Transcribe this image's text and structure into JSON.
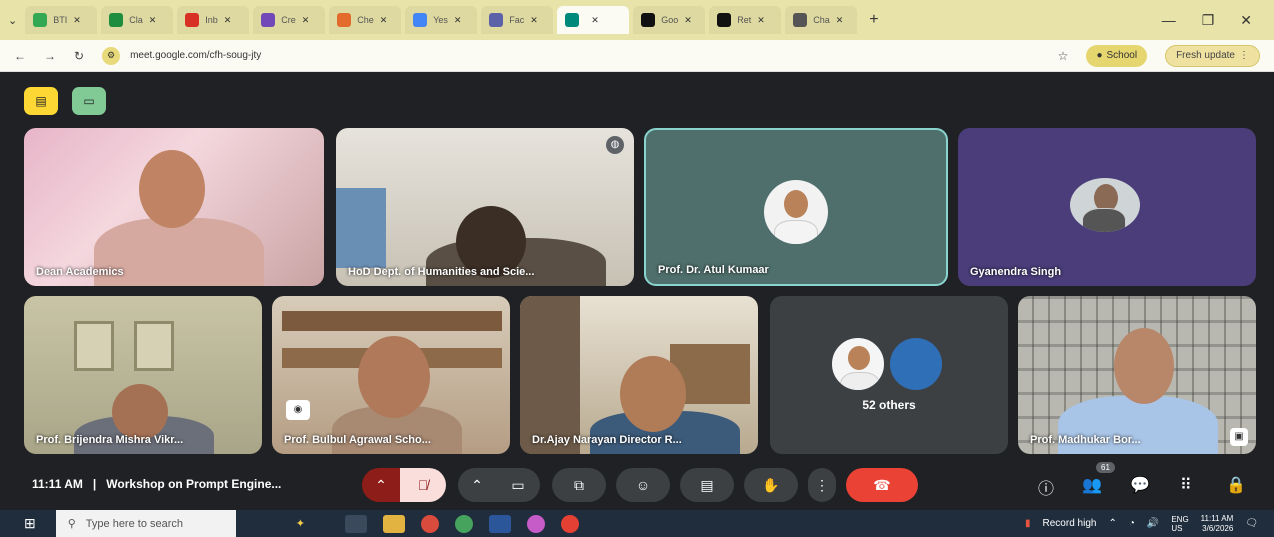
{
  "browser": {
    "tabs": [
      {
        "label": "BTI",
        "icon": "google-drive-icon",
        "color": "#34a853"
      },
      {
        "label": "Cla",
        "icon": "classroom-icon",
        "color": "#1e8e3e"
      },
      {
        "label": "Inb",
        "icon": "gmail-icon",
        "color": "#d93025"
      },
      {
        "label": "Cre",
        "icon": "forms-icon",
        "color": "#7248b9"
      },
      {
        "label": "Che",
        "icon": "ai-icon",
        "color": "#e36c2d"
      },
      {
        "label": "Yes",
        "icon": "star-icon",
        "color": "#4285f4"
      },
      {
        "label": "Fac",
        "icon": "heart-icon",
        "color": "#5b62a7"
      },
      {
        "label": "",
        "icon": "meet-icon",
        "color": "#00897b",
        "active": true
      },
      {
        "label": "Goo",
        "icon": "chatgpt-icon",
        "color": "#111111"
      },
      {
        "label": "Ret",
        "icon": "chatgpt-icon",
        "color": "#111111"
      },
      {
        "label": "Cha",
        "icon": "gear-icon",
        "color": "#555555"
      }
    ],
    "url": "meet.google.com/cfh-soug-jty",
    "profile_label": "School",
    "update_label": "Fresh update"
  },
  "participants": [
    {
      "name": "Dean Academics"
    },
    {
      "name": "HoD Dept. of Humanities and Scie..."
    },
    {
      "name": "Prof. Dr. Atul Kumaar"
    },
    {
      "name": "Gyanendra Singh"
    },
    {
      "name": "Prof. Brijendra Mishra Vikr..."
    },
    {
      "name": "Prof. Bulbul Agrawal Scho..."
    },
    {
      "name": "Dr.Ajay Narayan Director R..."
    },
    {
      "name": "52 others"
    },
    {
      "name": "Prof. Madhukar Bor..."
    }
  ],
  "meeting": {
    "time": "11:11 AM",
    "separator": "|",
    "title": "Workshop on Prompt Engine...",
    "people_count": "61"
  },
  "taskbar": {
    "search_placeholder": "Type here to search",
    "weather": "Record high",
    "lang": "ENG",
    "region": "US",
    "clock_time": "11:11 AM",
    "clock_date": "3/6/2026"
  },
  "colors": {
    "accent_red": "#ea4335",
    "meet_teal": "#4f6f6c",
    "meet_purple": "#4a3d7a"
  }
}
